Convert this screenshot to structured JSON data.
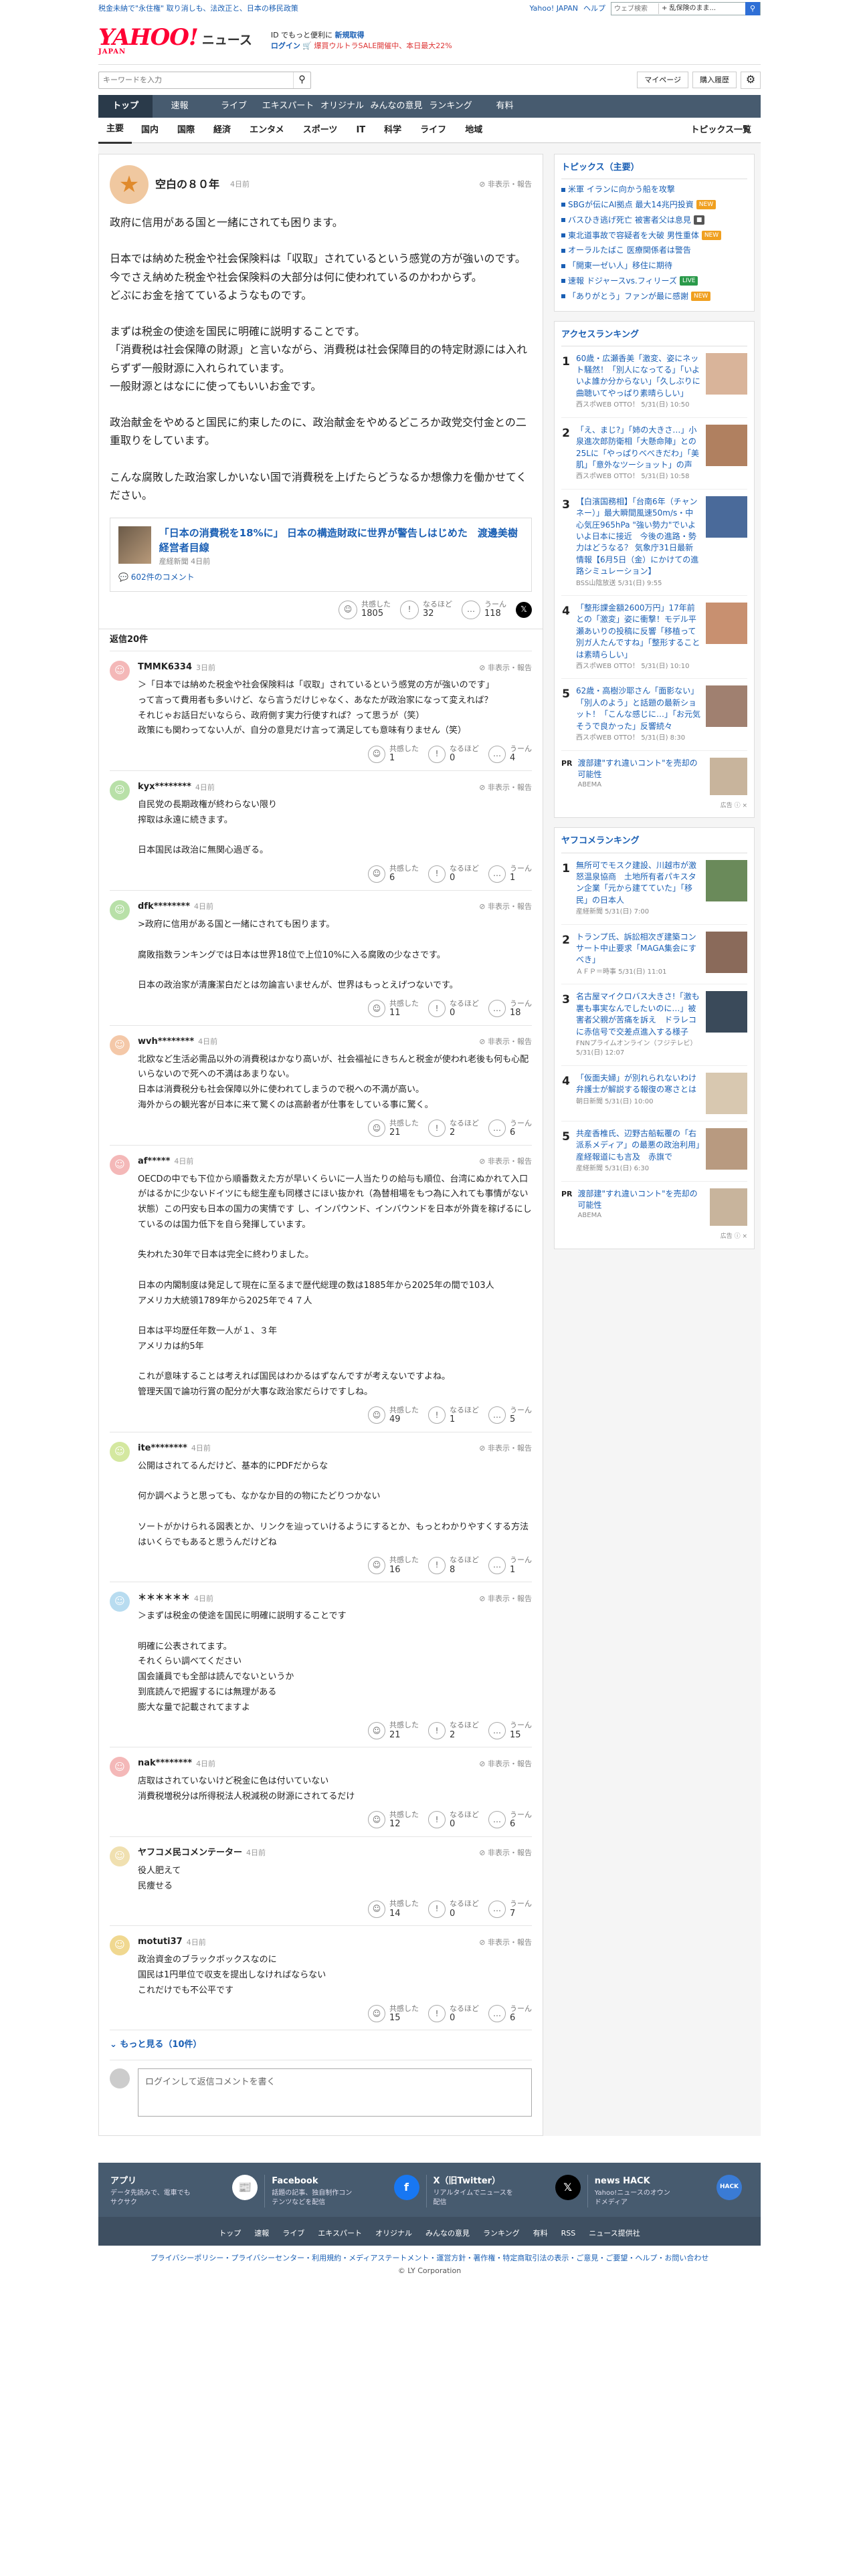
{
  "header": {
    "top_left_news": "税金未納で\"永住権\" 取り消しも、法改正と、日本の移民政策",
    "top_links": [
      "Yahoo! JAPAN",
      "ヘルプ"
    ],
    "search_placeholder": "ウェブ検索",
    "search_select": "+ 乱保険のまま...",
    "logo_main": "YAHOO!",
    "logo_sub": "JAPAN",
    "service": "ニュース",
    "promo_line1": "ID でもっと便利に",
    "promo_link": "新規取得",
    "promo_line2": "ログイン",
    "promo_sale": "🛒 爆買ウルトラSALE開催中、本日最大22%",
    "keyword_placeholder": "キーワードを入力",
    "mypage": "マイページ",
    "history": "購入履歴",
    "nav": [
      "トップ",
      "速報",
      "ライブ",
      "エキスパート",
      "オリジナル",
      "みんなの意見",
      "ランキング",
      "有料"
    ],
    "subnav": [
      "主要",
      "国内",
      "国際",
      "経済",
      "エンタメ",
      "スポーツ",
      "IT",
      "科学",
      "ライフ",
      "地域"
    ],
    "topics_list": "トピックス一覧"
  },
  "main_comment": {
    "user": "空白の８０年",
    "time": "4日前",
    "report": "非表示・報告",
    "text": "政府に信用がある国と一緒にされても困ります。\n\n日本では納めた税金や社会保険料は「収取」されているという感覚の方が強いのです。\n今でさえ納めた税金や社会保険料の大部分は何に使われているのかわからず。\nどぶにお金を捨てているようなものです。\n\nまずは税金の使途を国民に明確に説明することです。\n「消費税は社会保障の財源」と言いながら、消費税は社会保障目的の特定財源には入れらずず一般財源に入れられています。\n一般財源とはなにに使ってもいいお金です。\n\n政治献金をやめると国民に約束したのに、政治献金をやめるどころか政党交付金との二重取りをしています。\n\nこんな腐敗した政治家しかいない国で消費税を上げたらどうなるか想像力を働かせてください。",
    "article_title": "「日本の消費税を18%に」 日本の構造財政に世界が警告しはじめた　渡邊美樹　経営者目線",
    "article_source": "産経新聞 4日前",
    "article_comments": "602件のコメント",
    "likes_label": "共感した",
    "likes": "1805",
    "naruhodo_label": "なるほど",
    "naruhodo": "32",
    "uun_label": "うーん",
    "uun": "118"
  },
  "reply_header": "返信20件",
  "replies": [
    {
      "user": "TMMK6334",
      "time": "3日前",
      "color": "#f4b8b8",
      "text": "＞「日本では納めた税金や社会保険料は「収取」されているという感覚の方が強いのです」\nって言って費用者も多いけど、なら言うだけじゃなく、あなたが政治家になって変えれば？\nそれじゃお話日だいならら、政府側す実力行使すれば？って思うが（笑）\n政策にも関わってない人が、自分の意見だけ言って満足しても意味有りません（笑）",
      "likes": "1",
      "naruhodo": "0",
      "uun": "4"
    },
    {
      "user": "kyx********",
      "time": "4日前",
      "color": "#b8e0a8",
      "text": "自民党の長期政権が終わらない限り\n搾取は永遠に続きます。\n\n日本国民は政治に無関心過ぎる。",
      "likes": "6",
      "naruhodo": "0",
      "uun": "1"
    },
    {
      "user": "dfk********",
      "time": "4日前",
      "color": "#b8e0a8",
      "text": ">政府に信用がある国と一緒にされても困ります。\n\n腐敗指数ランキングでは日本は世界18位で上位10%に入る腐敗の少なさです。\n\n日本の政治家が清廉潔白だとは勿論言いませんが、世界はもっとえげつないです。",
      "likes": "11",
      "naruhodo": "0",
      "uun": "18"
    },
    {
      "user": "wvh********",
      "time": "4日前",
      "color": "#f4c8a8",
      "text": "北欧など生活必需品以外の消費税はかなり高いが、社会福祉にきちんと税金が使われ老後も何も心配いらないので死への不満はあまりない。\n日本は消費税分も社会保障以外に使われてしまうので税への不満が高い。\n海外からの観光客が日本に来て驚くのは高齢者が仕事をしている事に驚く。",
      "likes": "21",
      "naruhodo": "2",
      "uun": "6"
    },
    {
      "user": "af*****",
      "time": "4日前",
      "color": "#f4b8b8",
      "text": "OECDの中でも下位から順番数えた方が早いくらいに一人当たりの給与も順位、台湾にぬかれて入口がはるかに少ないドイツにも総生産も同様さにほい抜かれ（為替相場をもつ為に入れても事情がない状態）この円安も日本の国力の実情です し、インパウンド、インバウンドを日本が外貨を稼げるにしているのは国力低下を自ら発揮しています。\n\n失われた30年で日本は完全に終わりました。\n\n日本の内閣制度は発足して現在に至るまで歴代総理の数は1885年から2025年の間で103人\nアメリカ大統領1789年から2025年で４７人\n\n日本は平均歴任年数一人が１、３年\nアメリカは約5年\n\nこれが意味することは考えれば国民はわかるはずなんですが考えないですよね。\n管理天国で論功行賞の配分が大事な政治家だらけですしね。",
      "likes": "49",
      "naruhodo": "1",
      "uun": "5"
    },
    {
      "user": "ite********",
      "time": "4日前",
      "color": "#d4e8a0",
      "text": "公開はされてるんだけど、基本的にPDFだからな\n\n何か調べようと思っても、なかなか目的の物にたどりつかない\n\nソートがかけられる図表とか、リンクを辿っていけるようにするとか、もっとわかりやすくする方法はいくらでもあると思うんだけどね",
      "likes": "16",
      "naruhodo": "8",
      "uun": "1"
    },
    {
      "user": "＊＊＊＊＊＊",
      "time": "4日前",
      "color": "#b8dcf0",
      "text": "＞まずは税金の使途を国民に明確に説明することです\n\n明確に公表されてます。\nそれくらい調べてください\n国会議員でも全部は読んでないというか\n到底読んで把握するには無理がある\n膨大な量で記載されてますよ",
      "likes": "21",
      "naruhodo": "2",
      "uun": "15"
    },
    {
      "user": "nak********",
      "time": "4日前",
      "color": "#f4b8b8",
      "text": "店取はされていないけど税金に色は付いていない\n消費税増税分は所得税法人税減税の財源にされてるだけ",
      "likes": "12",
      "naruhodo": "0",
      "uun": "6"
    },
    {
      "user": "ヤフコメ民コメンテーター",
      "time": "4日前",
      "color": "#f0e0b0",
      "text": "役人肥えて\n民痩せる",
      "likes": "14",
      "naruhodo": "0",
      "uun": "7"
    },
    {
      "user": "motuti37",
      "time": "4日前",
      "color": "#f0d890",
      "text": "政治資金のブラックボックスなのに\n国民は1円単位で収支を提出しなければならない\nこれだけでも不公平です",
      "likes": "15",
      "naruhodo": "0",
      "uun": "6"
    }
  ],
  "more_label": "もっと見る（10件）",
  "login_placeholder": "ログインして返信コメントを書く",
  "sidebar": {
    "topics_title": "トピックス（主要）",
    "topics": [
      {
        "t": "米軍 イランに向かう船を攻撃",
        "tag": ""
      },
      {
        "t": "SBGが伝にAI拠点 最大14兆円投資",
        "tag": "new"
      },
      {
        "t": "バスひき逃げ死亡 被害者父は息見",
        "tag": "img"
      },
      {
        "t": "東北道事故で容疑者を大破 男性重体",
        "tag": "new"
      },
      {
        "t": "オーラルたばこ 医療関係者は警告",
        "tag": ""
      },
      {
        "t": "「開東一ゼい人」移住に期待",
        "tag": ""
      },
      {
        "t": "速報 ドジャースvs.フィリーズ",
        "tag": "live"
      },
      {
        "t": "「ありがとう」ファンが最に感謝",
        "tag": "new"
      }
    ],
    "access_title": "アクセスランキング",
    "access": [
      {
        "t": "60歳・広瀬香美「激変、姿にネット騒然！「別人になってる」「いよいよ誰か分からない」「久しぶりに曲聴いてやっぱり素晴らしい」",
        "s": "西スポWEB OTTO！ 5/31(日) 10:50",
        "c": "#d9b49a"
      },
      {
        "t": "「え、まじ?」「姉の大きさ…」小泉進次郎防衛相「大懸命陣」との25Lに「やっぱりべべきだわ」「美肌」「意外なツーショット」の声",
        "s": "西スポWEB OTTO！ 5/31(日) 10:58",
        "c": "#b08060"
      },
      {
        "t": "【白濱国務相】「台南6年（チャンネー）」最大瞬間風速50m/s・中心気圧965hPa \"強い勢力\"でいよいよ日本に接近　今後の進路・勢力はどうなる？ 気象庁31日最新情報【6月5日（金）にかけての進路シミュレーション】",
        "s": "BSS山陰放送 5/31(日) 9:55",
        "c": "#4a6a9a"
      },
      {
        "t": "「整形課金額2600万円」17年前との「激変」姿に衝撃！モデル平瀬あいりの投稿に反響「移植って別ガ人たんですね」「整形することは素晴らしい」",
        "s": "西スポWEB OTTO！ 5/31(日) 10:10",
        "c": "#c89070"
      },
      {
        "t": "62歳・高樹沙耶さん「面影ない」「別人のよう」と話題の最新ショット！「こんな感じに…」「お元気そうで良かった」反響続々",
        "s": "西スポWEB OTTO！ 5/31(日) 8:30",
        "c": "#a08070"
      }
    ],
    "pr1_title": "渡部建\"すれ違いコント\"を売却の可能性",
    "pr1_src": "ABEMA",
    "yafukome_title": "ヤフコメランキング",
    "yafukome": [
      {
        "t": "無所可でモスク建設、川越市が激怒温泉協商　土地所有者パキスタン企業「元から建てていた」「移民」の日本人",
        "s": "産経新聞 5/31(日) 7:00",
        "c": "#6a8a5a"
      },
      {
        "t": "トランプ氏、訴訟相次ぎ建築コンサート中止要求「MAGA集会にすべき」",
        "s": "ＡＦＰ＝時事 5/31(日) 11:01",
        "c": "#8a6a5a"
      },
      {
        "t": "名古屋マイクロバス大きさ!「激も裏も事実なんでしたいのに…」被害者父親が苦痛を訴え　ドラレコに赤信号で交差点進入する様子",
        "s": "FNNプライムオンライン（フジテレビ） 5/31(日) 12:07",
        "c": "#3a4a5a"
      },
      {
        "t": "「仮面夫婦」が別れられないわけ 弁護士が解説する報復の寒さとは",
        "s": "朝日新聞 5/31(日) 10:00",
        "c": "#d8c8b0"
      },
      {
        "t": "共産香椎氏、辺野古船転覆の「右派系メディア」の最悪の政治利用」産経報道にも言及　赤旗で",
        "s": "産経新聞 5/31(日) 6:30",
        "c": "#b89a80"
      }
    ],
    "pr2_title": "渡部建\"すれ違いコント\"を売却の可能性",
    "pr2_src": "ABEMA",
    "ad_label": "広告 ⓘ ×"
  },
  "footer": {
    "cols": [
      {
        "h": "アプリ",
        "p": "データ先読みで、電車でもサクサク",
        "icon": "📰"
      },
      {
        "h": "Facebook",
        "p": "話題の記事、独自制作コンテンツなどを配信",
        "icon": "f"
      },
      {
        "h": "X（旧Twitter）",
        "p": "リアルタイムでニュースを配信",
        "icon": "𝕏"
      },
      {
        "h": "news HACK",
        "p": "Yahoo!ニュースのオウンドメディア",
        "icon": "HACK"
      }
    ],
    "links": [
      "トップ",
      "速報",
      "ライブ",
      "エキスパート",
      "オリジナル",
      "みんなの意見",
      "ランキング",
      "有料",
      "RSS",
      "ニュース提供社"
    ],
    "legal": "プライバシーポリシー・プライバシーセンター・利用規約・メディアステートメント・運営方針・著作権・特定商取引法の表示・ご意見・ご要望・ヘルプ・お問い合わせ",
    "copy": "© LY Corporation"
  }
}
